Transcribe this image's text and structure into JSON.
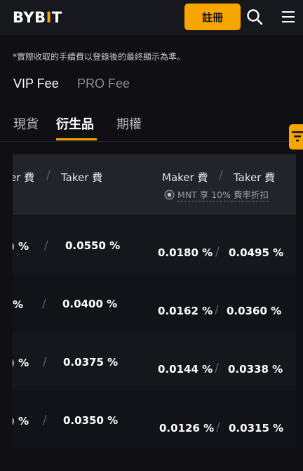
{
  "header": {
    "logo_text": "BYB",
    "logo_bar": "I",
    "logo_end": "T",
    "register_label": "註冊",
    "accent_color": "#f7a600"
  },
  "note": "*實際收取的手續費以登錄後的最終顯示為準。",
  "fee_tabs": [
    {
      "label": "VIP Fee",
      "active": true
    },
    {
      "label": "PRO Fee",
      "active": false
    }
  ],
  "product_tabs": [
    {
      "label": "現貨",
      "active": false
    },
    {
      "label": "衍生品",
      "active": true
    },
    {
      "label": "期權",
      "active": false
    }
  ],
  "table": {
    "left_header_maker": "er 費",
    "left_header_taker": "Taker 費",
    "right_header_maker": "Maker 費",
    "right_header_taker": "Taker 費",
    "discount_note": "MNT 享 10% 費率折扣",
    "rows": [
      {
        "left_maker": ") %",
        "left_taker": "0.0550 %",
        "right_maker": "0.0180 %",
        "right_taker": "0.0495 %"
      },
      {
        "left_maker": " %",
        "left_taker": "0.0400 %",
        "right_maker": "0.0162 %",
        "right_taker": "0.0360 %"
      },
      {
        "left_maker": ") %",
        "left_taker": "0.0375 %",
        "right_maker": "0.0144 %",
        "right_taker": "0.0338 %"
      },
      {
        "left_maker": ") %",
        "left_taker": "0.0350 %",
        "right_maker": "0.0126 %",
        "right_taker": "0.0315 %"
      }
    ]
  }
}
